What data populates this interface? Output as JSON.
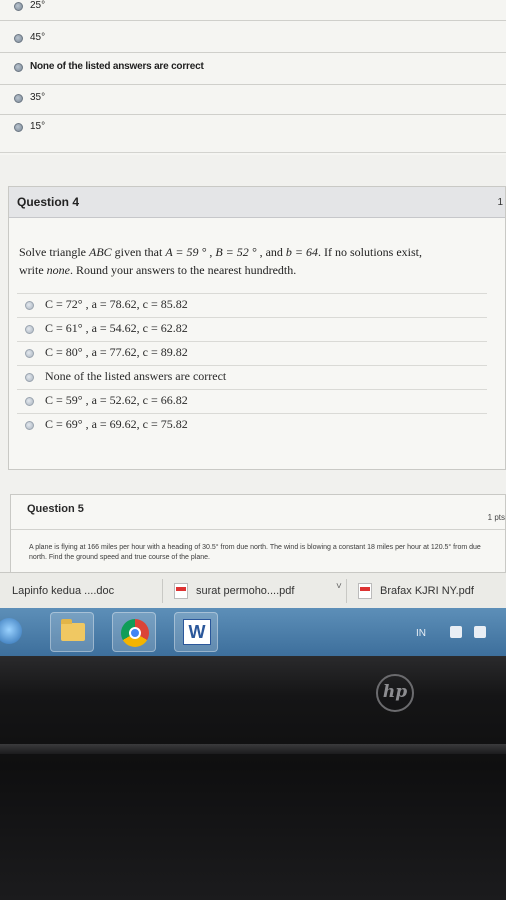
{
  "previous_question": {
    "options": [
      {
        "label": "25°"
      },
      {
        "label": "45°"
      },
      {
        "label": "None of the listed answers are correct"
      },
      {
        "label": "35°"
      },
      {
        "label": "15°"
      }
    ]
  },
  "question4": {
    "title": "Question 4",
    "points": "1",
    "text_prefix": "Solve triangle ",
    "triangle": "ABC",
    "text_given": " given that ",
    "given_A": "A = 59 °",
    "sep1": " , ",
    "given_B": "B = 52 °",
    "sep2": " , and ",
    "given_b": "b = 64",
    "text_after": ". If no solutions exist,",
    "text_line2_prefix": "write ",
    "none_word": "none",
    "text_line2_suffix": ". Round your answers to the nearest hundredth.",
    "options": [
      {
        "label": "C = 72° , a = 78.62, c = 85.82"
      },
      {
        "label": "C = 61° , a = 54.62, c = 62.82"
      },
      {
        "label": "C = 80° , a = 77.62, c = 89.82"
      },
      {
        "label": "None of the listed answers are correct"
      },
      {
        "label": "C = 59° , a = 52.62, c = 66.82"
      },
      {
        "label": "C = 69° , a = 69.62, c = 75.82"
      }
    ]
  },
  "question5": {
    "title": "Question 5",
    "points": "1 pts",
    "text": "A plane is flying at 166 miles per hour with a heading of 30.5° from due north. The wind is blowing a constant 18 miles per hour at 120.5° from due north. Find the ground speed and true course of the plane."
  },
  "downloads": [
    {
      "label": "Lapinfo kedua ....doc"
    },
    {
      "label": "surat permoho....pdf"
    },
    {
      "label": "Brafax KJRI NY.pdf"
    }
  ],
  "taskbar": {
    "lang": "IN",
    "word_letter": "W"
  },
  "bezel": {
    "logo_text": "hp"
  }
}
